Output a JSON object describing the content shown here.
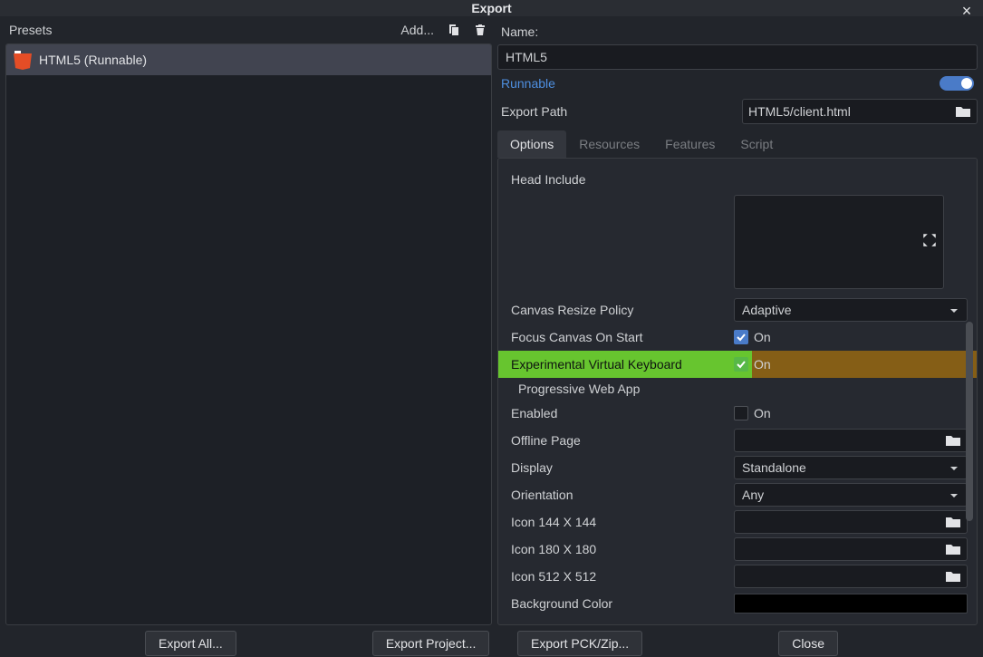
{
  "title": "Export",
  "presets_label": "Presets",
  "add_label": "Add...",
  "preset_item": "HTML5 (Runnable)",
  "name_label": "Name:",
  "name_value": "HTML5",
  "runnable_label": "Runnable",
  "export_path_label": "Export Path",
  "export_path_value": "HTML5/client.html",
  "tabs": {
    "options": "Options",
    "resources": "Resources",
    "features": "Features",
    "script": "Script"
  },
  "options": {
    "head_include": "Head Include",
    "canvas_resize_policy": "Canvas Resize Policy",
    "canvas_resize_value": "Adaptive",
    "focus_canvas": "Focus Canvas On Start",
    "exp_vkeyboard": "Experimental Virtual Keyboard",
    "pwa_header": "Progressive Web App",
    "enabled": "Enabled",
    "offline_page": "Offline Page",
    "display": "Display",
    "display_value": "Standalone",
    "orientation": "Orientation",
    "orientation_value": "Any",
    "icon144": "Icon 144 X 144",
    "icon180": "Icon 180 X 180",
    "icon512": "Icon 512 X 512",
    "background_color": "Background Color",
    "on_text": "On"
  },
  "buttons": {
    "export_all": "Export All...",
    "export_project": "Export Project...",
    "export_pck": "Export PCK/Zip...",
    "close": "Close"
  }
}
